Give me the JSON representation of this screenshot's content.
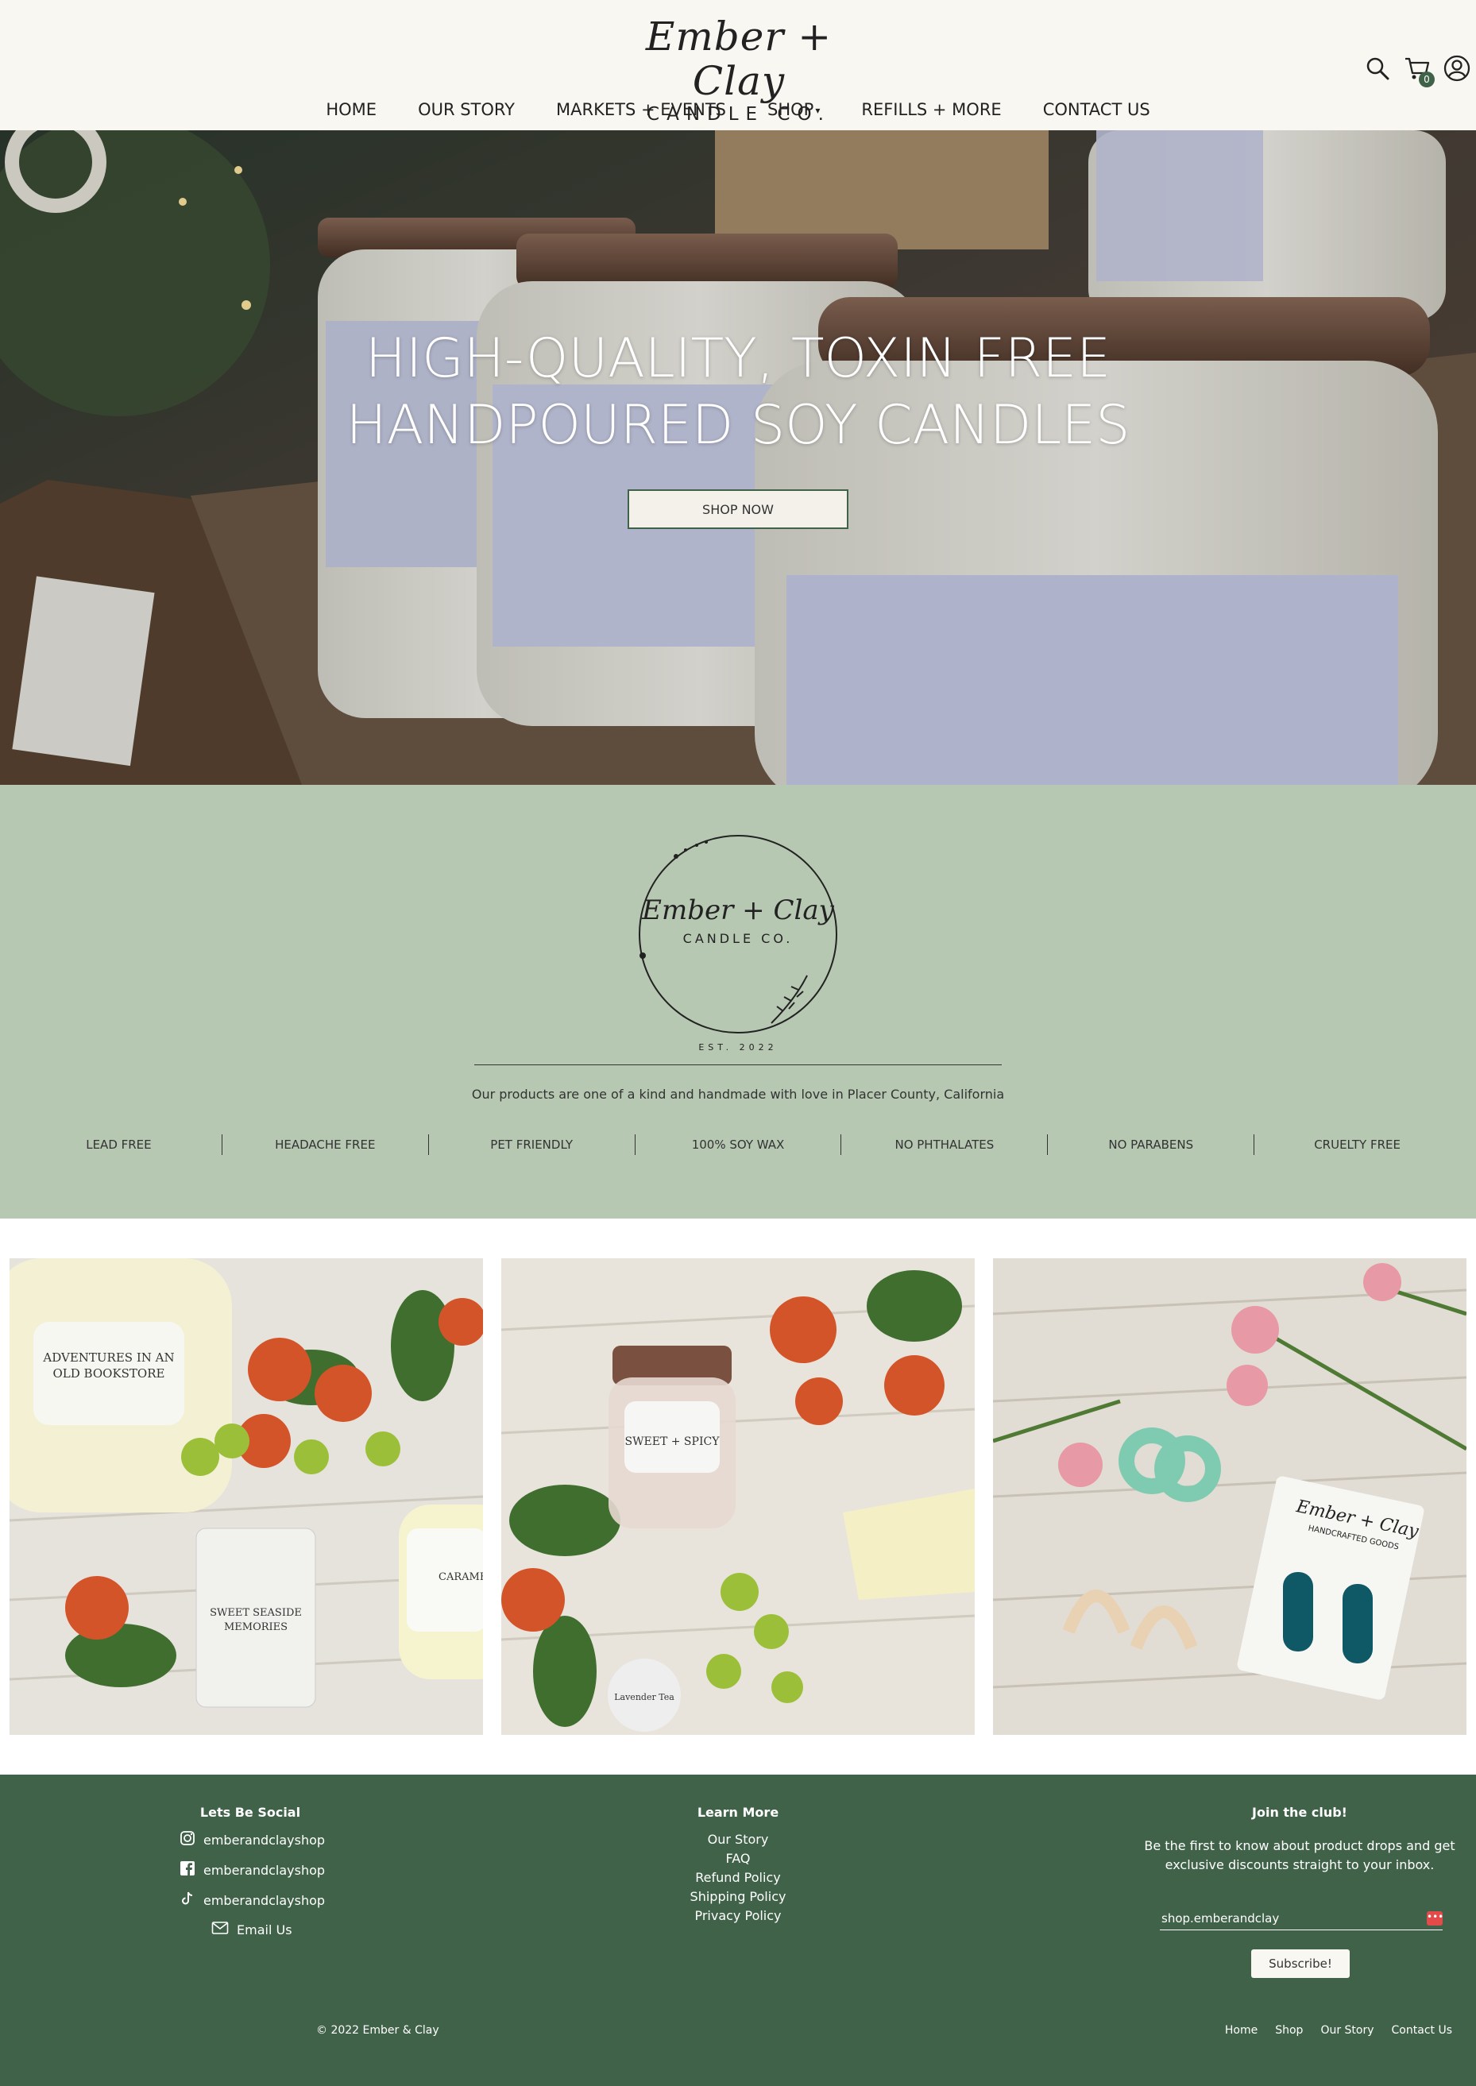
{
  "brand": {
    "logo_script": "Ember + Clay",
    "logo_sub": "CANDLE CO.",
    "seal_est": "EST. 2022"
  },
  "nav": {
    "items": [
      "HOME",
      "OUR STORY",
      "MARKETS + EVENTS",
      "SHOP",
      "REFILLS + MORE",
      "CONTACT US"
    ],
    "shop_caret": "▾"
  },
  "header": {
    "cart_count": "0",
    "icons": [
      "search-icon",
      "cart-icon",
      "account-icon"
    ]
  },
  "hero": {
    "title_line1": "HIGH-QUALITY, TOXIN FREE",
    "title_line2": "HANDPOURED SOY CANDLES",
    "cta": "SHOP NOW"
  },
  "about": {
    "tagline": "Our products are one of a kind and handmade with love in Placer County, California",
    "features": [
      "LEAD FREE",
      "HEADACHE FREE",
      "PET FRIENDLY",
      "100% SOY WAX",
      "NO PHTHALATES",
      "NO PARABENS",
      "CRUELTY FREE"
    ]
  },
  "gallery": {
    "photo1_labels": [
      "ADVENTURES IN AN OLD BOOKSTORE",
      "SWEET SEASIDE MEMORIES",
      "CARAMEL"
    ],
    "photo2_labels": [
      "SWEET + SPICY",
      "Lavender Tea"
    ],
    "photo3_labels": [
      "Ember + Clay",
      "HANDCRAFTED GOODS"
    ]
  },
  "footer": {
    "social_title": "Lets Be Social",
    "social": [
      {
        "icon": "instagram-icon",
        "label": "emberandclayshop"
      },
      {
        "icon": "facebook-icon",
        "label": "emberandclayshop"
      },
      {
        "icon": "tiktok-icon",
        "label": "emberandclayshop"
      },
      {
        "icon": "mail-icon",
        "label": "Email Us"
      }
    ],
    "learn_title": "Learn More",
    "learn": [
      "Our Story",
      "FAQ",
      "Refund Policy",
      "Shipping Policy",
      "Privacy Policy"
    ],
    "join_title": "Join the club!",
    "join_desc": "Be the first to know about product drops and get exclusive discounts straight to your inbox.",
    "email_value": "shop.emberandclay",
    "subscribe": "Subscribe!",
    "copyright": "© 2022 Ember & Clay",
    "bottom_links": [
      "Home",
      "Shop",
      "Our Story",
      "Contact Us"
    ]
  },
  "colors": {
    "header_bg": "#f9f7f2",
    "sage": "#b6c7b2",
    "forest": "#3f6249"
  }
}
